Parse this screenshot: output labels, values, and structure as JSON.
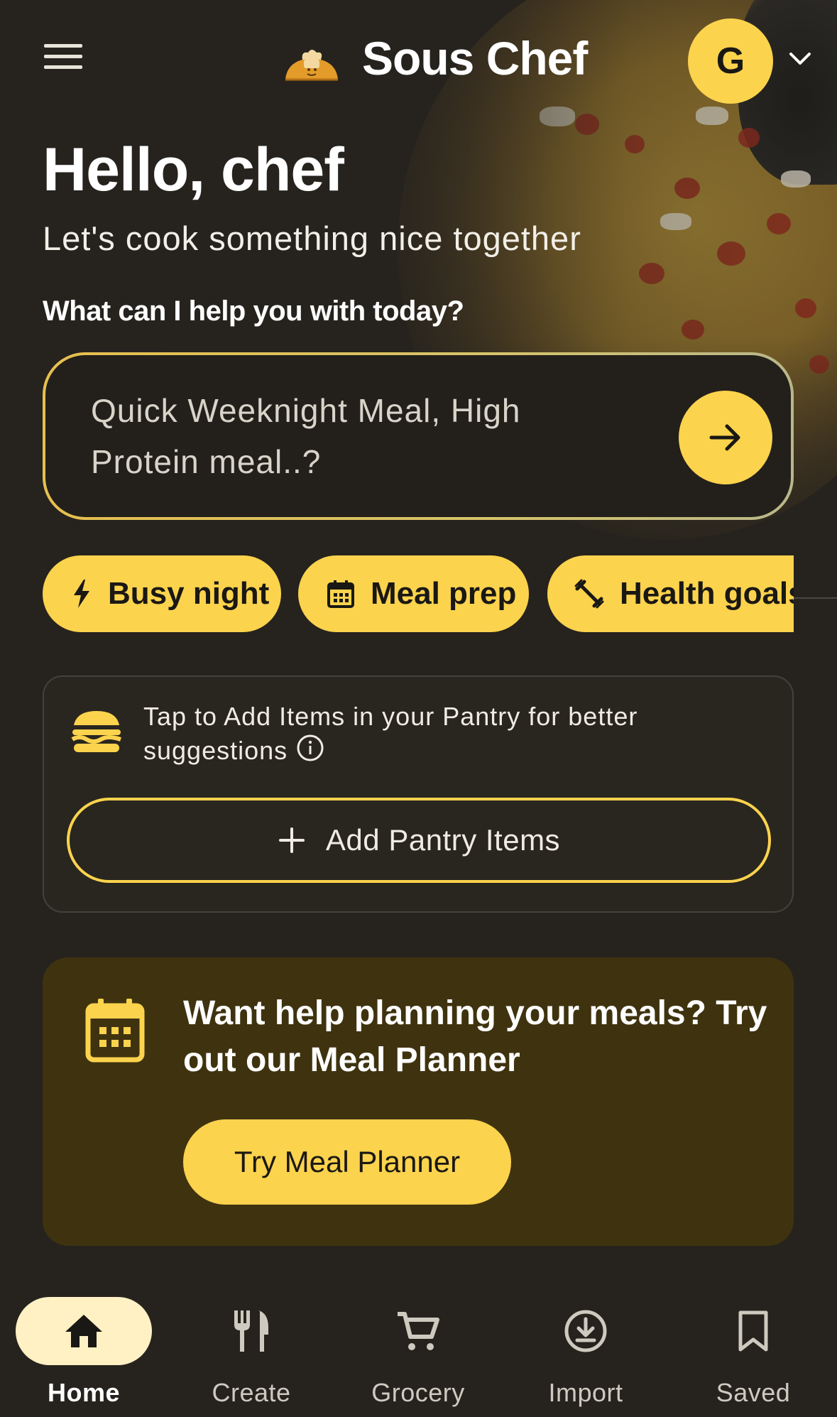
{
  "app": {
    "title": "Sous Chef"
  },
  "header": {
    "avatar_initial": "G"
  },
  "greeting": {
    "title": "Hello, chef",
    "subtitle": "Let's cook something nice together",
    "prompt": "What can I help you with today?"
  },
  "search": {
    "placeholder": "Quick Weeknight Meal, High Protein meal..?"
  },
  "chips": [
    {
      "label": "Busy night",
      "icon": "bolt-icon"
    },
    {
      "label": "Meal prep",
      "icon": "calendar-icon"
    },
    {
      "label": "Health goals",
      "icon": "dumbbell-icon"
    }
  ],
  "pantry": {
    "hint": "Tap to Add Items in your Pantry for better suggestions",
    "button_label": "Add Pantry Items",
    "icon": "burger-icon"
  },
  "planner": {
    "title": "Want help planning your meals? Try out our Meal Planner",
    "button_label": "Try Meal Planner",
    "icon": "calendar-icon"
  },
  "nav": [
    {
      "label": "Home",
      "icon": "home-icon",
      "active": true
    },
    {
      "label": "Create",
      "icon": "utensils-icon",
      "active": false
    },
    {
      "label": "Grocery",
      "icon": "cart-icon",
      "active": false
    },
    {
      "label": "Import",
      "icon": "download-icon",
      "active": false
    },
    {
      "label": "Saved",
      "icon": "bookmark-icon",
      "active": false
    }
  ],
  "colors": {
    "accent": "#fcd34d",
    "background": "#26231e",
    "planner_card": "#3f330f",
    "nav_active_pill": "#fff1c4"
  }
}
